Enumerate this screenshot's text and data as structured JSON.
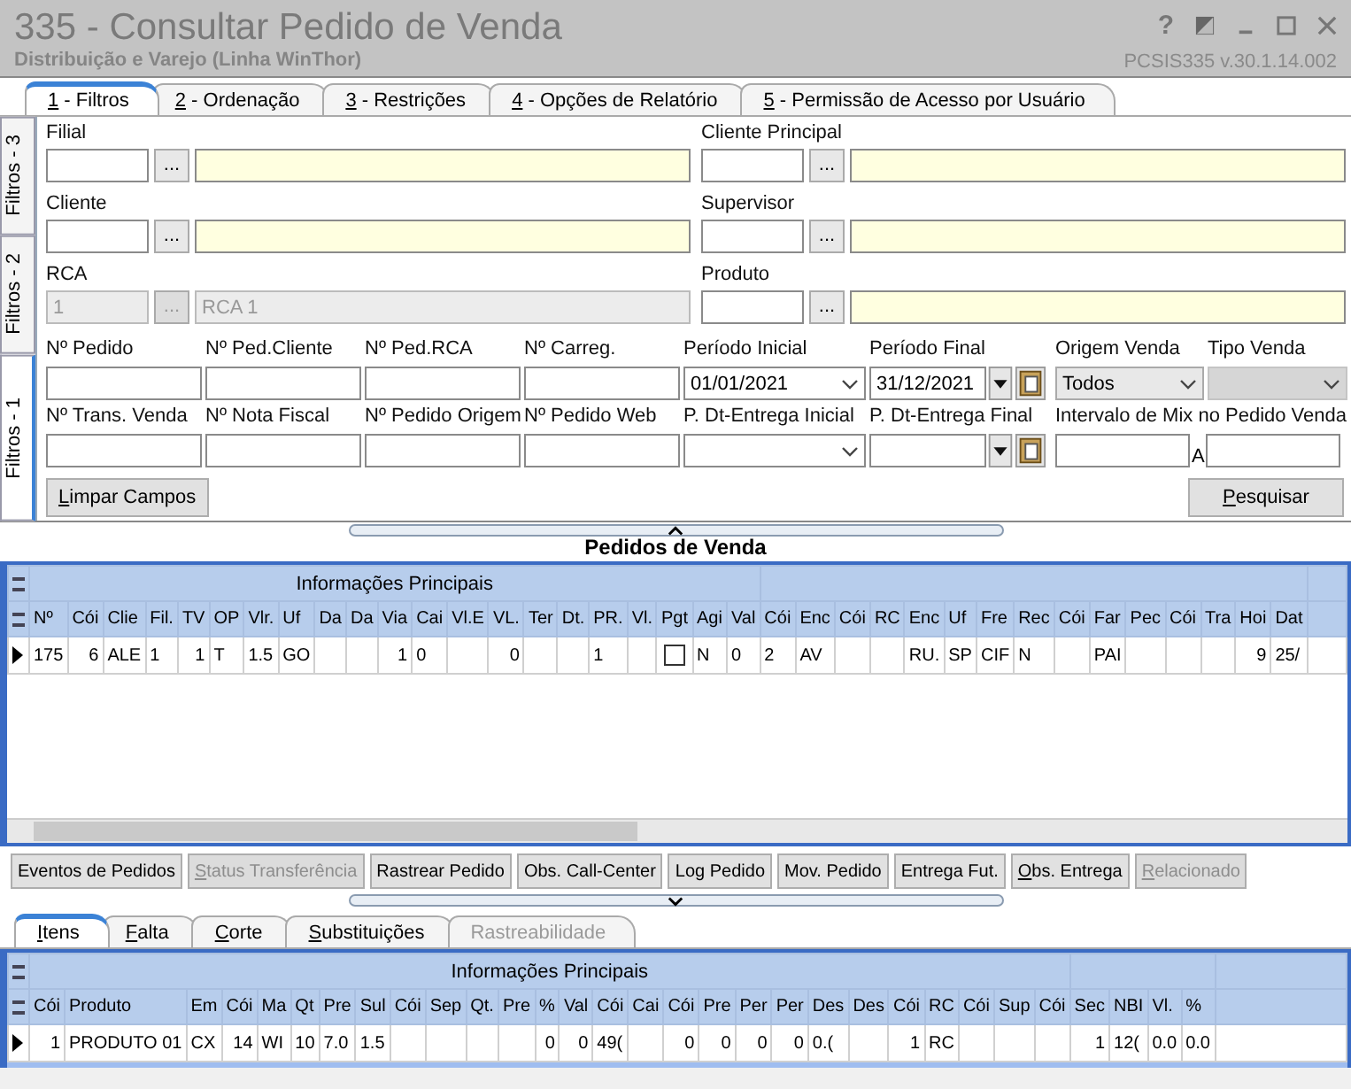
{
  "window": {
    "title": "335 - Consultar Pedido de Venda",
    "subtitle": "Distribuição e Varejo (Linha WinThor)",
    "help": "?",
    "version": "PCSIS335  v.30.1.14.002"
  },
  "tabs": [
    {
      "label": "1 - Filtros",
      "selected": true
    },
    {
      "label": "2 - Ordenação",
      "selected": false
    },
    {
      "label": "3 - Restrições",
      "selected": false
    },
    {
      "label": "4 - Opções de Relatório",
      "selected": false
    },
    {
      "label": "5 - Permissão de Acesso por Usuário",
      "selected": false
    }
  ],
  "side_tabs": [
    {
      "label": "Filtros - 3",
      "selected": false
    },
    {
      "label": "Filtros - 2",
      "selected": false
    },
    {
      "label": "Filtros - 1",
      "selected": true
    }
  ],
  "lookups": [
    {
      "label": "Filial",
      "disabled": false,
      "button": "..."
    },
    {
      "label": "Cliente Principal",
      "disabled": false,
      "button": "..."
    },
    {
      "label": "Cliente",
      "disabled": false,
      "button": "..."
    },
    {
      "label": "Supervisor",
      "disabled": false,
      "button": "..."
    },
    {
      "label": "RCA",
      "disabled": true,
      "code": "1",
      "button": "...",
      "description": "RCA 1"
    },
    {
      "label": "Produto",
      "disabled": false,
      "button": "..."
    }
  ],
  "fields": [
    {
      "label": "Nº Pedido",
      "kind": "text",
      "disabled": false
    },
    {
      "label": "Nº Ped.Cliente",
      "kind": "text",
      "disabled": false
    },
    {
      "label": "Nº Ped.RCA",
      "kind": "text",
      "disabled": false
    },
    {
      "label": "Nº Carreg.",
      "kind": "text",
      "disabled": false
    },
    {
      "label": "Período Inicial",
      "kind": "combo",
      "value": "01/01/2021",
      "disabled": false
    },
    {
      "label": "Período Final",
      "kind": "datepicker",
      "value": "31/12/2021",
      "disabled": false
    },
    {
      "label": "Origem Venda",
      "kind": "select",
      "value": "Todos",
      "disabled": false
    },
    {
      "label": "Tipo Venda",
      "kind": "select",
      "disabled": true
    },
    {
      "label": "Nº Trans. Venda",
      "kind": "text",
      "disabled": false
    },
    {
      "label": "Nº Nota Fiscal",
      "kind": "text",
      "disabled": false
    },
    {
      "label": "Nº Pedido Origem",
      "kind": "text",
      "disabled": false
    },
    {
      "label": "Nº Pedido Web",
      "kind": "text",
      "disabled": false
    },
    {
      "label": "P. Dt-Entrega Inicial",
      "kind": "combo",
      "disabled": false
    },
    {
      "label": "P. Dt-Entrega Final",
      "kind": "datepicker",
      "disabled": false
    },
    {
      "label": "Intervalo de Mix no Pedido Venda",
      "kind": "range",
      "separator": "A",
      "disabled": false
    }
  ],
  "clear_button": {
    "label": "Limpar Campos",
    "accelerator": true
  },
  "search_button": {
    "label": "Pesquisar",
    "accelerator": true
  },
  "orders": {
    "title": "Pedidos de  Venda",
    "groups": [
      {
        "title": "Informações Principais",
        "columns": [
          {
            "label": "Nº",
            "kind": "text",
            "cell": "175"
          },
          {
            "label": "Cói",
            "kind": "number",
            "cell": "6"
          },
          {
            "label": "Clie",
            "kind": "text",
            "cell": "ALE"
          },
          {
            "label": "Fil.",
            "kind": "text",
            "cell": "1"
          },
          {
            "label": "TV",
            "kind": "number",
            "cell": "1"
          },
          {
            "label": "OP",
            "kind": "text",
            "cell": "T"
          },
          {
            "label": "Vlr.",
            "kind": "text",
            "cell": "1.5"
          },
          {
            "label": "Uf",
            "kind": "text",
            "cell": "GO"
          },
          {
            "label": "Da",
            "kind": "text"
          },
          {
            "label": "Da",
            "kind": "text"
          },
          {
            "label": "Via",
            "kind": "number",
            "cell": "1"
          },
          {
            "label": "Cai",
            "kind": "text",
            "cell": "0"
          },
          {
            "label": "Vl.E",
            "kind": "text"
          },
          {
            "label": "VL.",
            "kind": "number",
            "cell": "0"
          },
          {
            "label": "Ter",
            "kind": "text"
          },
          {
            "label": "Dt.",
            "kind": "text"
          },
          {
            "label": "PR.",
            "kind": "text",
            "cell": "1"
          },
          {
            "label": "Vl.",
            "kind": "text"
          },
          {
            "label": "Pgt",
            "kind": "checkbox",
            "checked": false
          },
          {
            "label": "Agi",
            "kind": "text",
            "cell": "N"
          },
          {
            "label": "Val",
            "kind": "text",
            "cell": "0"
          }
        ]
      },
      {
        "columns": [
          {
            "label": "Cói",
            "kind": "text",
            "cell": "2"
          },
          {
            "label": "Enc",
            "kind": "text",
            "cell": "AV"
          },
          {
            "label": "Cói",
            "kind": "text"
          },
          {
            "label": "RC",
            "kind": "text"
          },
          {
            "label": "Enc",
            "kind": "text",
            "cell": "RU."
          },
          {
            "label": "Uf",
            "kind": "text",
            "cell": "SP"
          },
          {
            "label": "Fre",
            "kind": "text",
            "cell": "CIF"
          },
          {
            "label": "Rec",
            "kind": "text",
            "cell": "N"
          },
          {
            "label": "Cói",
            "kind": "text"
          },
          {
            "label": "Far",
            "kind": "text",
            "cell": "PAI"
          },
          {
            "label": "Pec",
            "kind": "text"
          },
          {
            "label": "Cói",
            "kind": "text"
          },
          {
            "label": "Tra",
            "kind": "text"
          },
          {
            "label": "Hoi",
            "kind": "number",
            "cell": "9"
          },
          {
            "label": "Dat",
            "kind": "text",
            "cell": "25/"
          }
        ]
      }
    ]
  },
  "buttons": [
    {
      "label": "Eventos de Pedidos",
      "disabled": false,
      "accelerator": false
    },
    {
      "label": "Status Transferência",
      "disabled": true,
      "accelerator": true
    },
    {
      "label": "Rastrear Pedido",
      "disabled": false,
      "accelerator": false
    },
    {
      "label": "Obs. Call-Center",
      "disabled": false,
      "accelerator": false
    },
    {
      "label": "Log Pedido",
      "disabled": false,
      "accelerator": false
    },
    {
      "label": "Mov. Pedido",
      "disabled": false,
      "accelerator": false
    },
    {
      "label": "Entrega Fut.",
      "disabled": false,
      "accelerator": false
    },
    {
      "label": "Obs. Entrega",
      "disabled": false,
      "accelerator": true
    },
    {
      "label": "Relacionado",
      "disabled": true,
      "accelerator": true
    }
  ],
  "detail_tabs": [
    {
      "label": "Itens",
      "selected": true,
      "disabled": false
    },
    {
      "label": "Falta",
      "selected": false,
      "disabled": false
    },
    {
      "label": "Corte",
      "selected": false,
      "disabled": false
    },
    {
      "label": "Substituições",
      "selected": false,
      "disabled": false
    },
    {
      "label": "Rastreabilidade",
      "selected": false,
      "disabled": true
    }
  ],
  "items": {
    "groups": [
      {
        "title": "Informações Principais",
        "columns": [
          {
            "label": "Cói",
            "kind": "number",
            "cell": "1"
          },
          {
            "label": "Produto",
            "kind": "text",
            "cell": "PRODUTO 01"
          },
          {
            "label": "Em",
            "kind": "text",
            "cell": "CX"
          },
          {
            "label": "Cói",
            "kind": "number",
            "cell": "14"
          },
          {
            "label": "Ma",
            "kind": "text",
            "cell": "WI"
          },
          {
            "label": "Qt",
            "kind": "text",
            "cell": "10"
          },
          {
            "label": "Pre",
            "kind": "text",
            "cell": "7.0"
          },
          {
            "label": "Sul",
            "kind": "text",
            "cell": "1.5"
          },
          {
            "label": "Cói",
            "kind": "text"
          },
          {
            "label": "Sep",
            "kind": "text"
          },
          {
            "label": "Qt.",
            "kind": "text"
          },
          {
            "label": "Pre",
            "kind": "text"
          },
          {
            "label": "%",
            "kind": "number",
            "cell": "0"
          },
          {
            "label": "Val",
            "kind": "number",
            "cell": "0"
          },
          {
            "label": "Cói",
            "kind": "text",
            "cell": "49("
          },
          {
            "label": "Cai",
            "kind": "text"
          },
          {
            "label": "Cói",
            "kind": "number",
            "cell": "0"
          },
          {
            "label": "Pre",
            "kind": "number",
            "cell": "0"
          },
          {
            "label": "Per",
            "kind": "number",
            "cell": "0"
          },
          {
            "label": "Per",
            "kind": "number",
            "cell": "0"
          },
          {
            "label": "Des",
            "kind": "text",
            "cell": "0.("
          },
          {
            "label": "Des",
            "kind": "text"
          },
          {
            "label": "Cói",
            "kind": "number",
            "cell": "1"
          },
          {
            "label": "RC",
            "kind": "text",
            "cell": "RC"
          },
          {
            "label": "Cói",
            "kind": "text"
          },
          {
            "label": "Sup",
            "kind": "text"
          },
          {
            "label": "Cói",
            "kind": "text"
          }
        ]
      },
      {
        "columns": [
          {
            "label": "Sec",
            "kind": "number",
            "cell": "1"
          },
          {
            "label": "NBI",
            "kind": "text",
            "cell": "12("
          },
          {
            "label": "Vl.",
            "kind": "text",
            "cell": "0.0"
          },
          {
            "label": "%",
            "kind": "text",
            "cell": "0.0"
          }
        ]
      }
    ]
  }
}
